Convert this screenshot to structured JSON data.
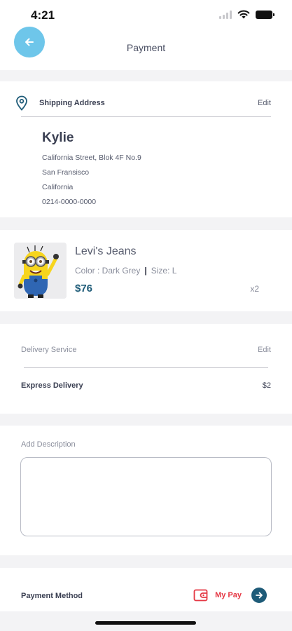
{
  "status_bar": {
    "time": "4:21"
  },
  "header": {
    "title": "Payment"
  },
  "shipping": {
    "title": "Shipping Address",
    "edit_label": "Edit",
    "name": "Kylie",
    "lines": [
      "California Street, Blok 4F No.9",
      "San Fransisco",
      "California",
      "0214-0000-0000"
    ]
  },
  "product": {
    "name": "Levi's Jeans",
    "color": "Color : Dark Grey",
    "size": "Size:  L",
    "price": "$76",
    "qty": "x2"
  },
  "delivery": {
    "label": "Delivery Service",
    "edit_label": "Edit",
    "service": "Express Delivery",
    "price": "$2"
  },
  "description": {
    "label": "Add Description",
    "value": ""
  },
  "payment": {
    "label": "Payment Method",
    "method": "My Pay"
  },
  "colors": {
    "back_button": "#6ec6ea",
    "price": "#1e5b78",
    "pay_method": "#e53945"
  },
  "icons": {
    "back": "arrow-left-icon",
    "location": "location-pin-icon",
    "wallet": "wallet-icon",
    "next": "arrow-right-icon"
  }
}
